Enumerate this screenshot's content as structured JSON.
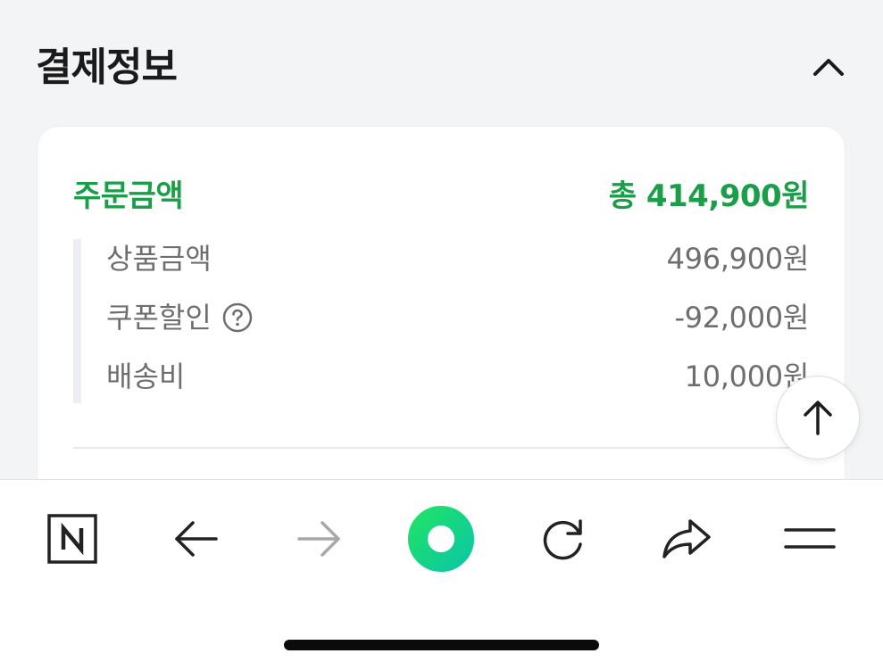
{
  "section": {
    "title": "결제정보",
    "collapse_icon": "chevron-up-icon"
  },
  "order": {
    "total_label": "주문금액",
    "total_value": "총 414,900원",
    "accent_color": "#1a9e48",
    "lines": [
      {
        "label": "상품금액",
        "value": "496,900원"
      },
      {
        "label": "쿠폰할인",
        "value": "-92,000원",
        "help_icon": "question-circle-icon"
      },
      {
        "label": "배송비",
        "value": "10,000원"
      }
    ]
  },
  "scroll_top_icon": "arrow-up-icon",
  "toolbar": {
    "items": [
      {
        "name": "naver-home-button",
        "icon": "naver-n-icon"
      },
      {
        "name": "back-button",
        "icon": "arrow-left-icon"
      },
      {
        "name": "forward-button",
        "icon": "arrow-right-icon",
        "disabled": true
      },
      {
        "name": "green-dot-button",
        "icon": "green-dot-icon",
        "color": "#0fd67a"
      },
      {
        "name": "reload-button",
        "icon": "reload-icon"
      },
      {
        "name": "share-button",
        "icon": "share-icon"
      },
      {
        "name": "menu-button",
        "icon": "menu-icon"
      }
    ]
  }
}
